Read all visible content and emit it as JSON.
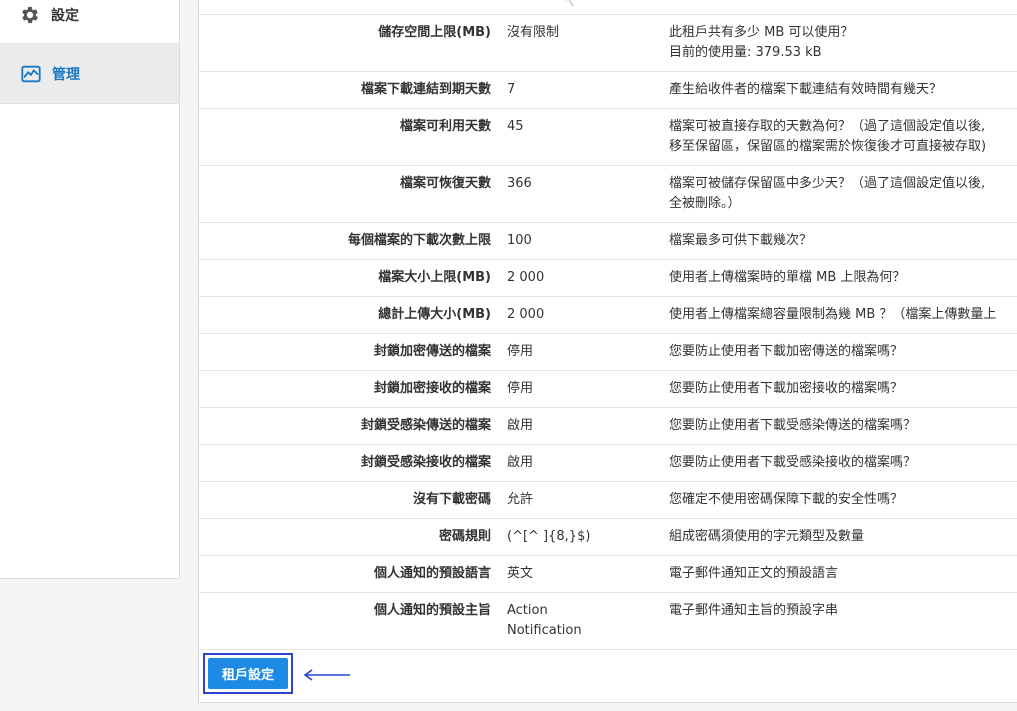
{
  "sidebar": {
    "items": [
      {
        "label": "設定",
        "icon": "gear-icon"
      },
      {
        "label": "管理",
        "icon": "chart-icon",
        "active": true
      }
    ]
  },
  "top_strip": {
    "fragment": "ㄟ"
  },
  "rows": [
    {
      "key": "儲存空間上限(MB)",
      "value": [
        "沒有限制"
      ],
      "desc": [
        "此租戶共有多少 MB 可以使用？",
        "目前的使用量: 379.53 kB"
      ]
    },
    {
      "key": "檔案下載連結到期天數",
      "value": [
        "7"
      ],
      "desc": [
        "產生給收件者的檔案下載連結有效時間有幾天？"
      ]
    },
    {
      "key": "檔案可利用天數",
      "value": [
        "45"
      ],
      "desc": [
        "檔案可被直接存取的天數為何？（過了這個設定值以後,",
        "移至保留區，保留區的檔案需於恢復後才可直接被存取)"
      ]
    },
    {
      "key": "檔案可恢復天數",
      "value": [
        "366"
      ],
      "desc": [
        "檔案可被儲存保留區中多少天？（過了這個設定值以後,",
        "全被刪除。）"
      ]
    },
    {
      "key": "每個檔案的下載次數上限",
      "value": [
        "100"
      ],
      "desc": [
        "檔案最多可供下載幾次？"
      ]
    },
    {
      "key": "檔案大小上限(MB)",
      "value": [
        "2 000"
      ],
      "desc": [
        "使用者上傳檔案時的單檔 MB 上限為何？"
      ]
    },
    {
      "key": "總計上傳大小(MB)",
      "value": [
        "2 000"
      ],
      "desc": [
        "使用者上傳檔案總容量限制為幾 MB ？（檔案上傳數量上"
      ]
    },
    {
      "key": "封鎖加密傳送的檔案",
      "value": [
        "停用"
      ],
      "desc": [
        "您要防止使用者下載加密傳送的檔案嗎？"
      ]
    },
    {
      "key": "封鎖加密接收的檔案",
      "value": [
        "停用"
      ],
      "desc": [
        "您要防止使用者下載加密接收的檔案嗎？"
      ]
    },
    {
      "key": "封鎖受感染傳送的檔案",
      "value": [
        "啟用"
      ],
      "desc": [
        "您要防止使用者下載受感染傳送的檔案嗎？"
      ]
    },
    {
      "key": "封鎖受感染接收的檔案",
      "value": [
        "啟用"
      ],
      "desc": [
        "您要防止使用者下載受感染接收的檔案嗎？"
      ]
    },
    {
      "key": "沒有下載密碼",
      "value": [
        "允許"
      ],
      "desc": [
        "您確定不使用密碼保障下載的安全性嗎？"
      ]
    },
    {
      "key": "密碼規則",
      "value": [
        "(^[^ ]{8,}$)"
      ],
      "desc": [
        "組成密碼須使用的字元類型及數量"
      ]
    },
    {
      "key": "個人通知的預設語言",
      "value": [
        "英文"
      ],
      "desc": [
        "電子郵件通知正文的預設語言"
      ]
    },
    {
      "key": "個人通知的預設主旨",
      "value": [
        "Action",
        "Notification"
      ],
      "desc": [
        "電子郵件通知主旨的預設字串"
      ]
    }
  ],
  "actions": {
    "tenant_settings_label": "租戶設定"
  },
  "colors": {
    "accent": "#1d8be6",
    "highlight": "#2c43d6",
    "active_sidebar_text": "#1a78c2"
  }
}
